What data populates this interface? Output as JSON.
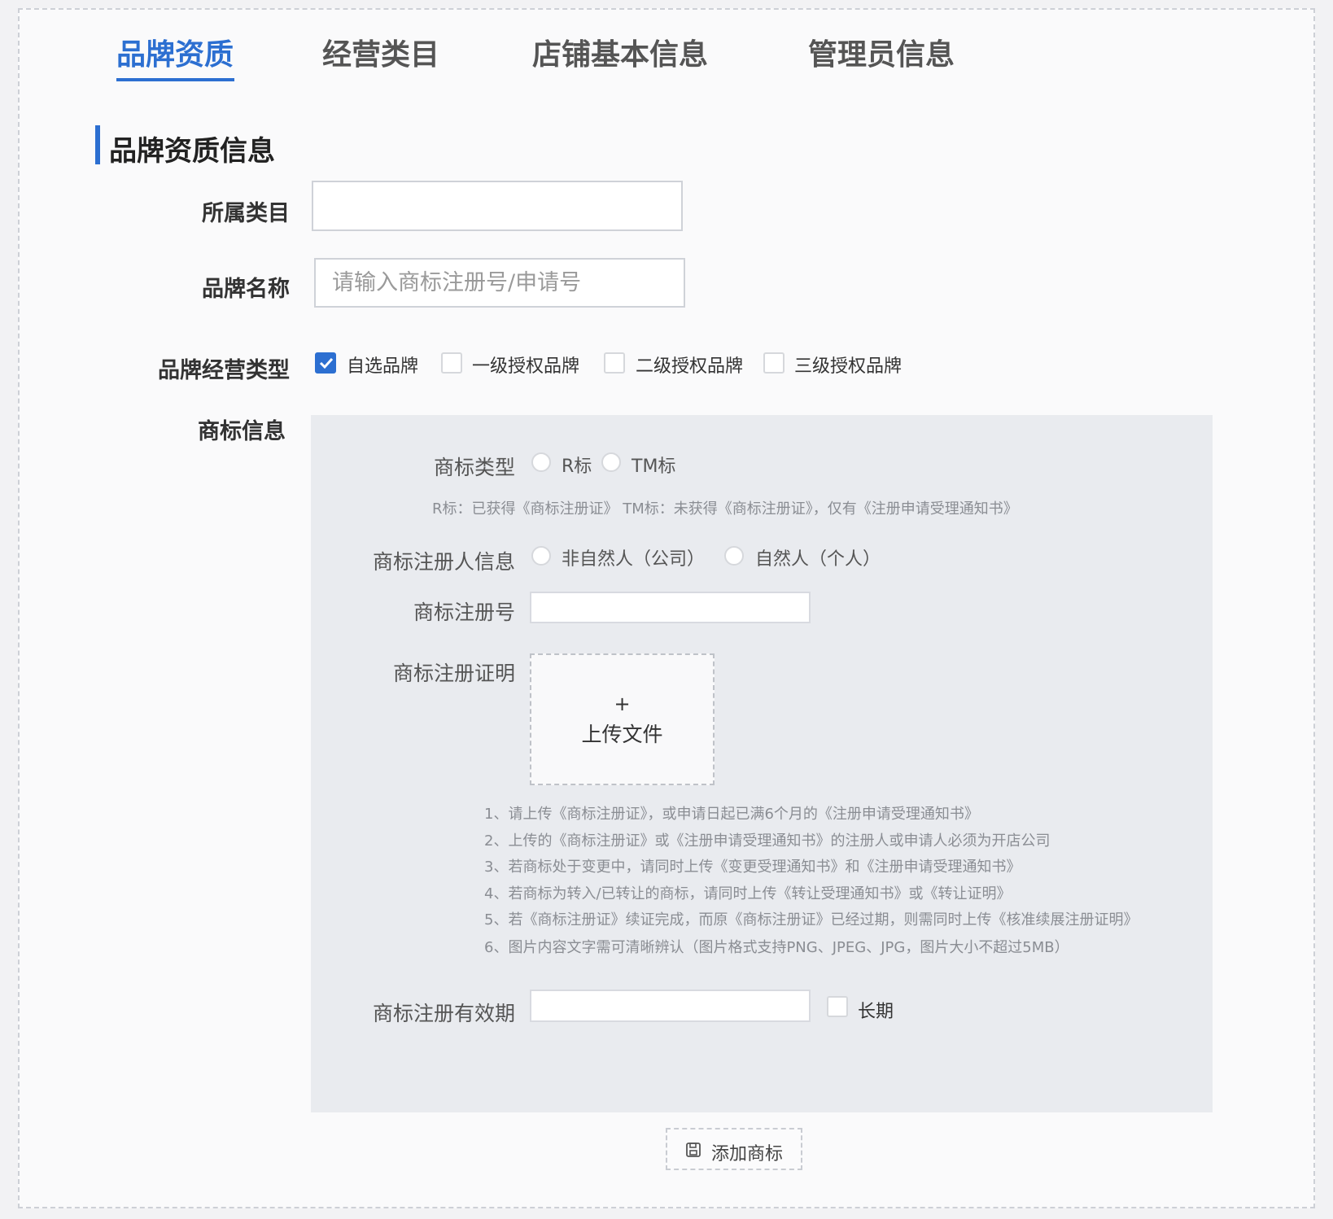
{
  "tabs": [
    {
      "label": "品牌资质",
      "active": true
    },
    {
      "label": "经营类目",
      "active": false
    },
    {
      "label": "店铺基本信息",
      "active": false
    },
    {
      "label": "管理员信息",
      "active": false
    }
  ],
  "section": {
    "title": "品牌资质信息"
  },
  "form": {
    "category": {
      "label": "所属类目",
      "value": ""
    },
    "brand_name": {
      "label": "品牌名称",
      "placeholder": "请输入商标注册号/申请号",
      "value": ""
    },
    "brand_type": {
      "label": "品牌经营类型",
      "options": [
        {
          "label": "自选品牌",
          "checked": true
        },
        {
          "label": "一级授权品牌",
          "checked": false
        },
        {
          "label": "二级授权品牌",
          "checked": false
        },
        {
          "label": "三级授权品牌",
          "checked": false
        }
      ]
    },
    "trademark_info_label": "商标信息"
  },
  "trademark": {
    "type": {
      "label": "商标类型",
      "options": [
        "R标",
        "TM标"
      ]
    },
    "type_hint": "R标：已获得《商标注册证》 TM标：未获得《商标注册证》，仅有《注册申请受理通知书》",
    "registrant": {
      "label": "商标注册人信息",
      "options": [
        "非自然人（公司）",
        "自然人（个人）"
      ]
    },
    "reg_no": {
      "label": "商标注册号",
      "value": ""
    },
    "certificate": {
      "label": "商标注册证明",
      "upload_plus": "+",
      "upload_text": "上传文件"
    },
    "notes": [
      "1、请上传《商标注册证》，或申请日起已满6个月的《注册申请受理通知书》",
      "2、上传的《商标注册证》或《注册申请受理通知书》的注册人或申请人必须为开店公司",
      "3、若商标处于变更中，请同时上传《变更受理通知书》和《注册申请受理通知书》",
      "4、若商标为转入/已转让的商标，请同时上传《转让受理通知书》或《转让证明》",
      "5、若《商标注册证》续证完成，而原《商标注册证》已经过期，则需同时上传《核准续展注册证明》",
      "6、图片内容文字需可清晰辨认（图片格式支持PNG、JPEG、JPG，图片大小不超过5MB）"
    ],
    "validity": {
      "label": "商标注册有效期",
      "value": "",
      "long_term_label": "长期",
      "long_term_checked": false
    }
  },
  "add_button": {
    "label": "添加商标"
  },
  "colors": {
    "accent": "#2c6fd1",
    "panel_bg": "#e9ebef"
  }
}
